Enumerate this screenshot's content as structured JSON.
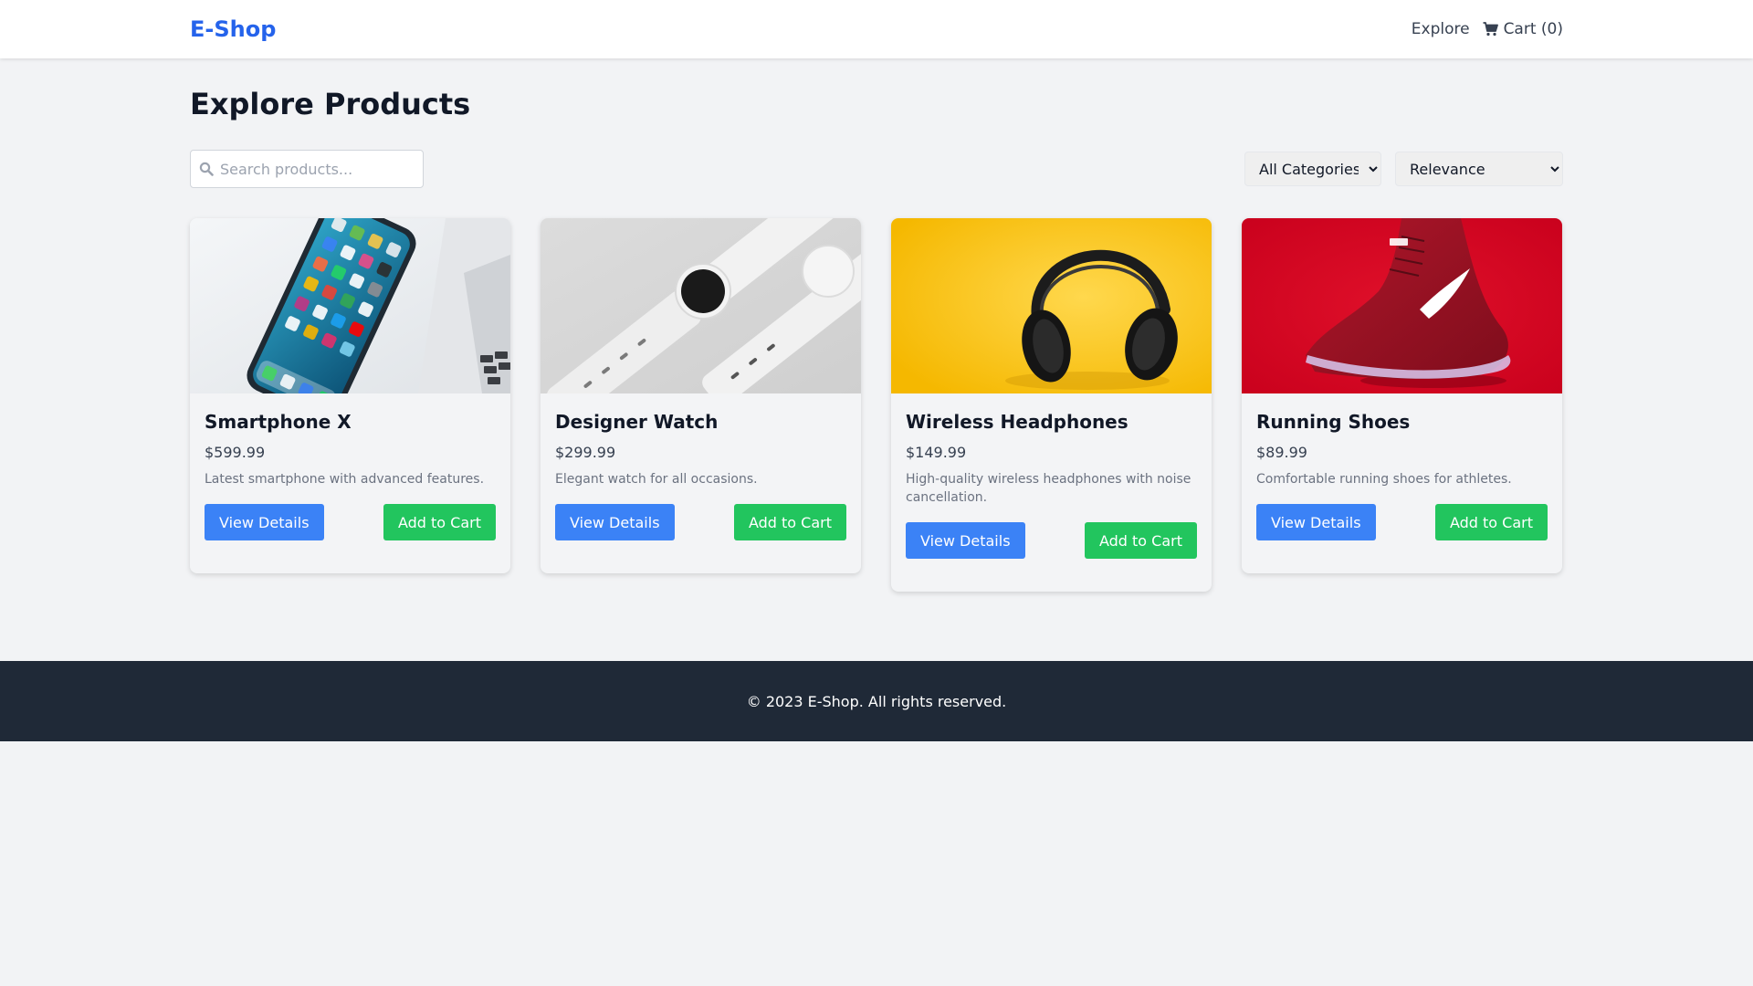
{
  "header": {
    "brand": "E-Shop",
    "nav": {
      "explore": "Explore",
      "cart": "Cart (0)"
    },
    "cart_icon": "cart-icon"
  },
  "main": {
    "title": "Explore Products",
    "search": {
      "placeholder": "Search products...",
      "value": "",
      "icon": "search-icon"
    },
    "category_filter": {
      "selected": "All Categories"
    },
    "sort": {
      "selected": "Relevance"
    }
  },
  "products": [
    {
      "name": "Smartphone X",
      "price": "$599.99",
      "description": "Latest smartphone with advanced features.",
      "view_label": "View Details",
      "cart_label": "Add to Cart",
      "image": "smartphone-photo"
    },
    {
      "name": "Designer Watch",
      "price": "$299.99",
      "description": "Elegant watch for all occasions.",
      "view_label": "View Details",
      "cart_label": "Add to Cart",
      "image": "watch-photo"
    },
    {
      "name": "Wireless Headphones",
      "price": "$149.99",
      "description": "High-quality wireless headphones with noise cancellation.",
      "view_label": "View Details",
      "cart_label": "Add to Cart",
      "image": "headphones-photo"
    },
    {
      "name": "Running Shoes",
      "price": "$89.99",
      "description": "Comfortable running shoes for athletes.",
      "view_label": "View Details",
      "cart_label": "Add to Cart",
      "image": "shoes-photo"
    }
  ],
  "footer": {
    "text": "© 2023 E-Shop. All rights reserved."
  },
  "colors": {
    "brand": "#2563eb",
    "primary_button": "#3b82f6",
    "success_button": "#22c55e",
    "footer_bg": "#1f2937",
    "page_bg": "#f2f3f5"
  }
}
